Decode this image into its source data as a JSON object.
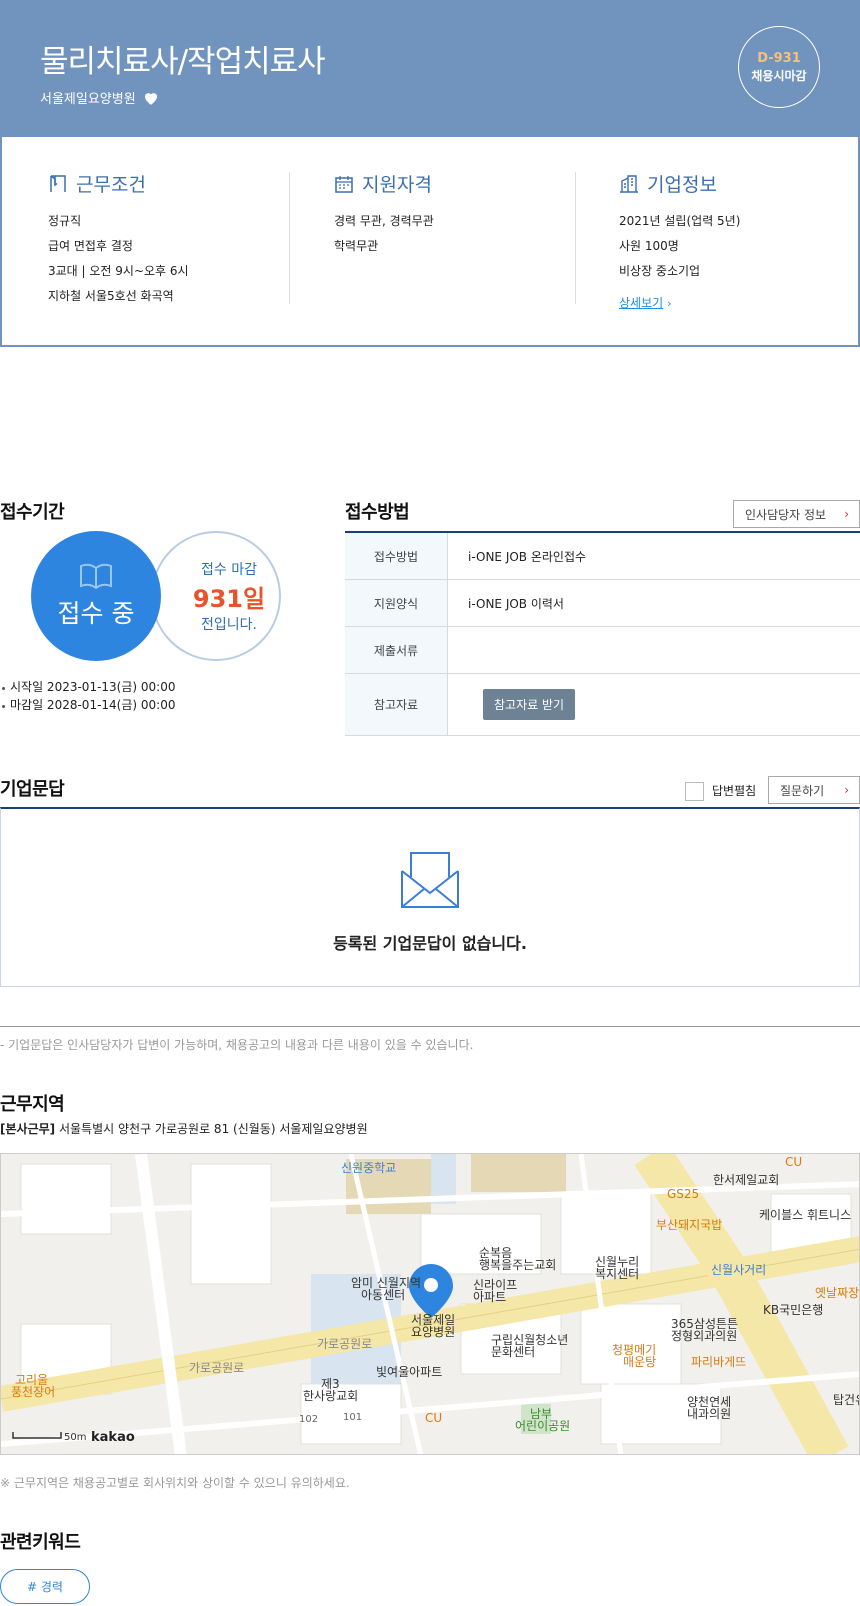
{
  "header": {
    "job_title": "물리치료사/작업치료사",
    "company": "서울제일요양병원",
    "dday": "D-931",
    "status": "채용시마감"
  },
  "conditions": {
    "title": "근무조건",
    "items": [
      "정규직",
      "급여 면접후 결정",
      "3교대 | 오전 9시~오후 6시",
      "지하철 서울5호선 화곡역"
    ]
  },
  "qualifications": {
    "title": "지원자격",
    "items": [
      "경력 무관, 경력무관",
      "학력무관"
    ]
  },
  "company_info": {
    "title": "기업정보",
    "items": [
      "2021년 설립(업력 5년)",
      "사원 100명",
      "비상장 중소기업"
    ],
    "detail_link": "상세보기"
  },
  "period": {
    "title": "접수기간",
    "status_label": "접수 중",
    "deadline_line1": "접수 마감",
    "deadline_days": "931일",
    "deadline_line3": "전입니다.",
    "start": "시작일 2023-01-13(금) 00:00",
    "end": "마감일 2028-01-14(금) 00:00"
  },
  "method": {
    "title": "접수방법",
    "hr_button": "인사담당자 정보",
    "rows": [
      {
        "label": "접수방법",
        "value": "i-ONE JOB 온라인접수"
      },
      {
        "label": "지원양식",
        "value": "i-ONE JOB 이력서"
      },
      {
        "label": "제출서류",
        "value": ""
      },
      {
        "label": "참고자료",
        "button": "참고자료 받기"
      }
    ]
  },
  "qa": {
    "title": "기업문답",
    "checkbox_label": "답변펼침",
    "ask_button": "질문하기",
    "empty_text": "등록된 기업문답이 없습니다.",
    "note": "- 기업문답은 인사담당자가 답변이 가능하며, 채용공고의 내용과 다른 내용이 있을 수 있습니다."
  },
  "location": {
    "title": "근무지역",
    "tag": "[본사근무]",
    "address": "서울특별시 양천구 가로공원로 81 (신월동) 서울제일요양병원",
    "note": "※ 근무지역은 채용공고별로 회사위치와 상이할 수 있으니 유의하세요.",
    "map": {
      "labels": {
        "school": "신원중학교",
        "church1": "한서제일교회",
        "gs25": "GS25",
        "cu1": "CU",
        "restaurant1": "부산돼지국밥",
        "apt1": "케이블스 휘트니스",
        "church2a": "순복음",
        "church2b": "행복을주는교회",
        "welfare_a": "신월누리",
        "welfare_b": "복지센터",
        "crossroad": "신월사거리",
        "old": "옛날짜장",
        "center_a": "암미 신월지역",
        "center_b": "아동센터",
        "hospital_a": "서울제일",
        "hospital_b": "요양병원",
        "apt2a": "신라이프",
        "apt2b": "아파트",
        "road1": "가로공원로",
        "road2": "가로공원로",
        "kb": "KB국민은행",
        "clinic_a": "365삼성튼튼",
        "clinic_b": "정형외과의원",
        "youth_a": "구립신월청소년",
        "youth_b": "문화센터",
        "rest2a": "청평메기",
        "rest2b": "매운탕",
        "paris": "파리바게뜨",
        "goril_a": "고리울",
        "goril_b": "풍천장어",
        "apt3": "빛여울아파트",
        "church3a": "제3",
        "church3b": "한사랑교회",
        "b102": "102",
        "b101": "101",
        "cu2": "CU",
        "park_a": "남부",
        "park_b": "어린이공원",
        "yangcheon_a": "양천연세",
        "yangcheon_b": "내과의원",
        "tap": "탑건유",
        "scale": "50m",
        "brand": "kakao"
      }
    }
  },
  "keywords": {
    "title": "관련키워드",
    "items": [
      "# 경력"
    ]
  },
  "colors": {
    "header_bg": "#7194bf",
    "accent_blue": "#2e85e0",
    "deadline_red": "#e8532b",
    "table_border": "#1a3e7a"
  }
}
